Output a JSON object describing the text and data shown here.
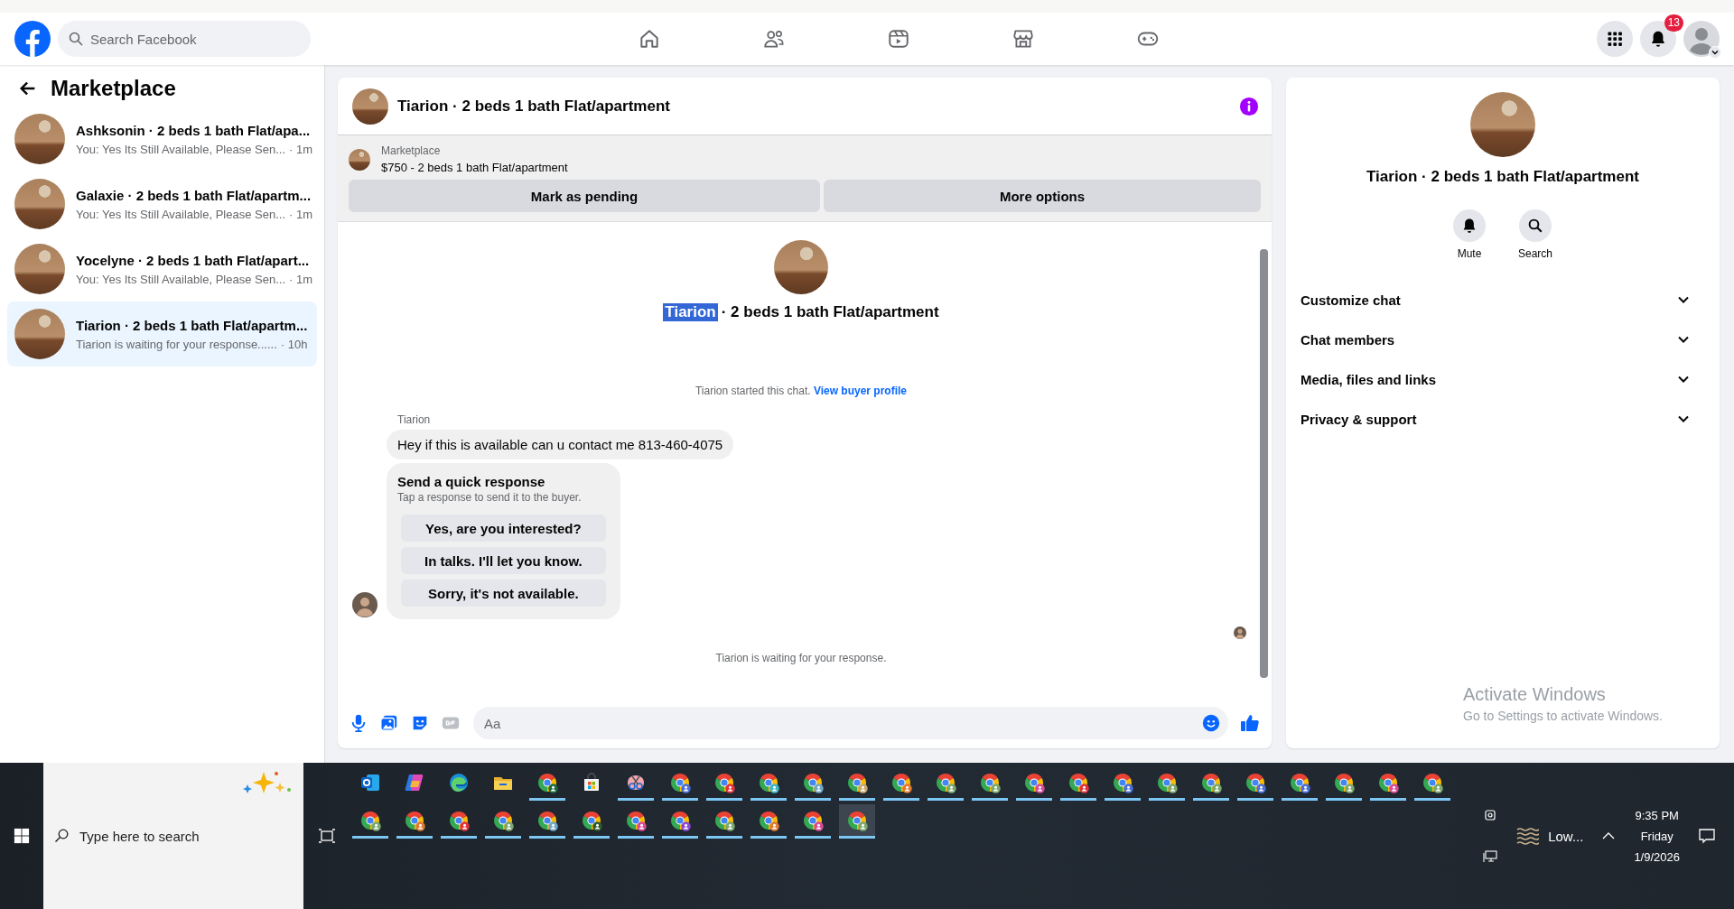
{
  "top_bar": {
    "search_placeholder": "Search Facebook",
    "notification_count": "13"
  },
  "sidebar": {
    "title": "Marketplace",
    "conversations": [
      {
        "title": "Ashksonin · 2 beds 1 bath Flat/apa...",
        "snippet": "You: Yes Its Still Available, Please Sen...",
        "time": "· 1m",
        "selected": false
      },
      {
        "title": "Galaxie · 2 beds 1 bath Flat/apartm...",
        "snippet": "You: Yes Its Still Available, Please Sen...",
        "time": "· 1m",
        "selected": false
      },
      {
        "title": "Yocelyne · 2 beds 1 bath Flat/apart...",
        "snippet": "You: Yes Its Still Available, Please Sen...",
        "time": "· 1m",
        "selected": false
      },
      {
        "title": "Tiarion · 2 beds 1 bath Flat/apartm...",
        "snippet": "Tiarion is waiting for your response......",
        "time": "· 10h",
        "selected": true
      }
    ]
  },
  "chat": {
    "title": "Tiarion · 2 beds 1 bath Flat/apartment",
    "listing": {
      "label": "Marketplace",
      "price_title": "$750 - 2 beds 1 bath Flat/apartment",
      "actions": [
        "Mark as pending",
        "More options"
      ]
    },
    "intro": {
      "name": "Tiarion",
      "name_highlighted": true,
      "rest": "· 2 beds 1 bath Flat/apartment"
    },
    "started_note": "Tiarion started this chat.",
    "profile_link": "View buyer profile",
    "sender": "Tiarion",
    "message": "Hey if this is available can u contact me 813-460-4075",
    "quick_response": {
      "title": "Send a quick response",
      "hint": "Tap a response to send it to the buyer.",
      "options": [
        "Yes, are you interested?",
        "In talks. I'll let you know.",
        "Sorry, it's not available."
      ]
    },
    "status": "Tiarion is waiting for your response.",
    "composer_placeholder": "Aa"
  },
  "details": {
    "title": "Tiarion · 2 beds 1 bath Flat/apartment",
    "actions": [
      {
        "kind": "mute",
        "label": "Mute"
      },
      {
        "kind": "search",
        "label": "Search"
      }
    ],
    "sections": [
      {
        "label": "Customize chat",
        "expanded": false
      },
      {
        "label": "Chat members",
        "expanded": false
      },
      {
        "label": "Media, files and links",
        "expanded": false
      },
      {
        "label": "Privacy & support",
        "expanded": false
      }
    ]
  },
  "os_notice": {
    "title": "Activate Windows",
    "hint": "Go to Settings to activate Windows."
  },
  "taskbar": {
    "search_placeholder": "Type here to search",
    "apps": [
      {
        "kind": "outlook",
        "running": false,
        "selected": false
      },
      {
        "kind": "copilot",
        "running": false,
        "selected": false
      },
      {
        "kind": "edge",
        "running": false,
        "selected": false
      },
      {
        "kind": "files",
        "running": false,
        "selected": false
      },
      {
        "kind": "chrome",
        "color": "#1e6b40",
        "running": true,
        "selected": false
      },
      {
        "kind": "store",
        "running": false,
        "selected": false
      },
      {
        "kind": "snip",
        "running": true,
        "selected": false
      },
      {
        "kind": "chrome",
        "color": "#4a6fd8",
        "running": true,
        "selected": false
      },
      {
        "kind": "chrome",
        "color": "#e0323c",
        "running": true,
        "selected": false
      },
      {
        "kind": "chrome",
        "color": "#3fb6c8",
        "running": true,
        "selected": false
      },
      {
        "kind": "chrome",
        "color": "#6ea8c8",
        "running": true,
        "selected": false
      },
      {
        "kind": "chrome",
        "color": "#c8a86e",
        "running": true,
        "selected": false
      },
      {
        "kind": "chrome",
        "color": "#e07a30",
        "running": true,
        "selected": false
      },
      {
        "kind": "chrome",
        "color": "#7aa86e",
        "running": true,
        "selected": false
      },
      {
        "kind": "chrome",
        "color": "#7aa86e",
        "running": true,
        "selected": false
      },
      {
        "kind": "chrome",
        "color": "#d84a9a",
        "running": true,
        "selected": false
      },
      {
        "kind": "chrome",
        "color": "#e0323c",
        "running": true,
        "selected": false
      },
      {
        "kind": "chrome",
        "color": "#4a6fd8",
        "running": true,
        "selected": false
      },
      {
        "kind": "chrome",
        "color": "#7aa86e",
        "running": true,
        "selected": false
      },
      {
        "kind": "chrome",
        "color": "#7aa86e",
        "running": true,
        "selected": false
      },
      {
        "kind": "chrome",
        "color": "#4a6fd8",
        "running": true,
        "selected": false
      },
      {
        "kind": "chrome",
        "color": "#4a6fd8",
        "running": true,
        "selected": false
      },
      {
        "kind": "chrome",
        "color": "#7aa86e",
        "running": true,
        "selected": false
      },
      {
        "kind": "chrome",
        "color": "#d84a9a",
        "running": true,
        "selected": false
      },
      {
        "kind": "chrome",
        "color": "#7aa86e",
        "running": true,
        "selected": false
      },
      {
        "kind": "chrome",
        "color": "#7aa86e",
        "running": true,
        "selected": false
      },
      {
        "kind": "chrome",
        "color": "#e07a30",
        "running": true,
        "selected": false
      },
      {
        "kind": "chrome",
        "color": "#e0323c",
        "running": true,
        "selected": false
      },
      {
        "kind": "chrome",
        "color": "#7aa86e",
        "running": true,
        "selected": false
      },
      {
        "kind": "chrome",
        "color": "#6ea8c8",
        "running": true,
        "selected": false
      },
      {
        "kind": "chrome",
        "color": "#2f5a2f",
        "running": true,
        "selected": false
      },
      {
        "kind": "chrome",
        "color": "#d84a9a",
        "running": true,
        "selected": false
      },
      {
        "kind": "chrome",
        "color": "#8a4ad8",
        "running": true,
        "selected": false
      },
      {
        "kind": "chrome",
        "color": "#7aa86e",
        "running": true,
        "selected": false
      },
      {
        "kind": "chrome",
        "color": "#e07a30",
        "running": true,
        "selected": false
      },
      {
        "kind": "chrome",
        "color": "#d84a9a",
        "running": true,
        "selected": false
      },
      {
        "kind": "chrome",
        "color": "#7aa86e",
        "running": true,
        "selected": true
      }
    ],
    "weather": "Low...",
    "time": "9:35 PM",
    "day": "Friday",
    "date": "1/9/2026"
  }
}
